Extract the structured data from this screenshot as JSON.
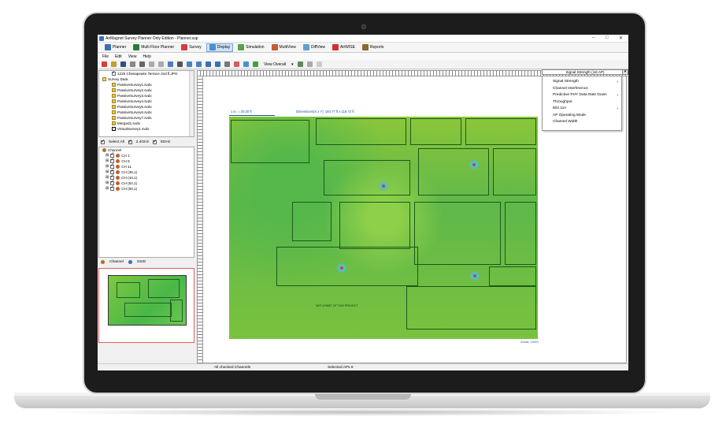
{
  "window": {
    "title": "AirMagnet Survey Planner Only Edition - Planner.sup"
  },
  "app_tabs": [
    {
      "label": "Planner",
      "icon": "planner-icon",
      "color": "#3a6fb0"
    },
    {
      "label": "Multi Floor Planner",
      "icon": "multi-floor-icon",
      "color": "#2a7a3a"
    },
    {
      "label": "Survey",
      "icon": "survey-icon",
      "color": "#d04040"
    },
    {
      "label": "Display",
      "icon": "display-icon",
      "color": "#4a90d0"
    },
    {
      "label": "Simulation",
      "icon": "simulation-icon",
      "color": "#5aa050"
    },
    {
      "label": "MultiView",
      "icon": "multiview-icon",
      "color": "#c06030"
    },
    {
      "label": "DiffView",
      "icon": "diffview-icon",
      "color": "#60a0d0"
    },
    {
      "label": "AirWISE",
      "icon": "airwise-icon",
      "color": "#d03030"
    },
    {
      "label": "Reports",
      "icon": "reports-icon",
      "color": "#8a6a30"
    }
  ],
  "menu": [
    "File",
    "Edit",
    "View",
    "Help"
  ],
  "toolbar": {
    "view_label": "View Overall"
  },
  "tree": [
    {
      "label": "1225 Chesapeake Terrace 2nd fl.JPG",
      "indent": 2,
      "kind": "check"
    },
    {
      "label": "Survey Data",
      "indent": 0,
      "kind": "folder"
    },
    {
      "label": "PassiveSurvey1.svdx",
      "indent": 2,
      "kind": "p"
    },
    {
      "label": "PassiveSurvey2.svdx",
      "indent": 2,
      "kind": "p"
    },
    {
      "label": "PassiveSurvey3.svdx",
      "indent": 2,
      "kind": "p"
    },
    {
      "label": "PassiveSurvey4.svdx",
      "indent": 2,
      "kind": "p"
    },
    {
      "label": "PassiveSurvey5.svdx",
      "indent": 2,
      "kind": "p"
    },
    {
      "label": "PassiveSurvey6.svdx",
      "indent": 2,
      "kind": "p"
    },
    {
      "label": "PassiveSurvey7.svdx",
      "indent": 2,
      "kind": "p"
    },
    {
      "label": "Merged1.svdx",
      "indent": 2,
      "kind": "p"
    },
    {
      "label": "VirtualSurvey1.svdx",
      "indent": 2,
      "kind": "v"
    }
  ],
  "bands": {
    "select_all": "Select All",
    "b24": "2.4GHz",
    "b5": "5GHz"
  },
  "channel_root": "Channel",
  "channels": [
    "CH 1",
    "CH 6",
    "CH 11",
    "CH (36,1)",
    "CH (44,1)",
    "CH (52,1)",
    "CH (60,1)"
  ],
  "bottom_toggle": {
    "channel": "Channel",
    "ssid": "SSID"
  },
  "canvas": {
    "scale_label": "1 in. = 20.30 ft",
    "dimensions": "Dimensions(X x Y): 184.77 ft x 118.72 ft",
    "floor_note": "NOT A PART OF THIS PROJECT",
    "zoom": "Zoom: 144%"
  },
  "display_dropdown": "Signal Strength (1st AP)",
  "display_menu": [
    {
      "label": "Signal Strength",
      "submenu": true
    },
    {
      "label": "Channel Interference",
      "submenu": false
    },
    {
      "label": "Predictive PHY Data Rate Down",
      "submenu": true
    },
    {
      "label": "Throughput",
      "submenu": false
    },
    {
      "label": "802.11n",
      "submenu": true
    },
    {
      "label": "AP Operating Mode",
      "submenu": false
    },
    {
      "label": "Channel Width",
      "submenu": false
    }
  ],
  "status": {
    "left": "All checked Channels",
    "right": "Selected APs 8"
  }
}
